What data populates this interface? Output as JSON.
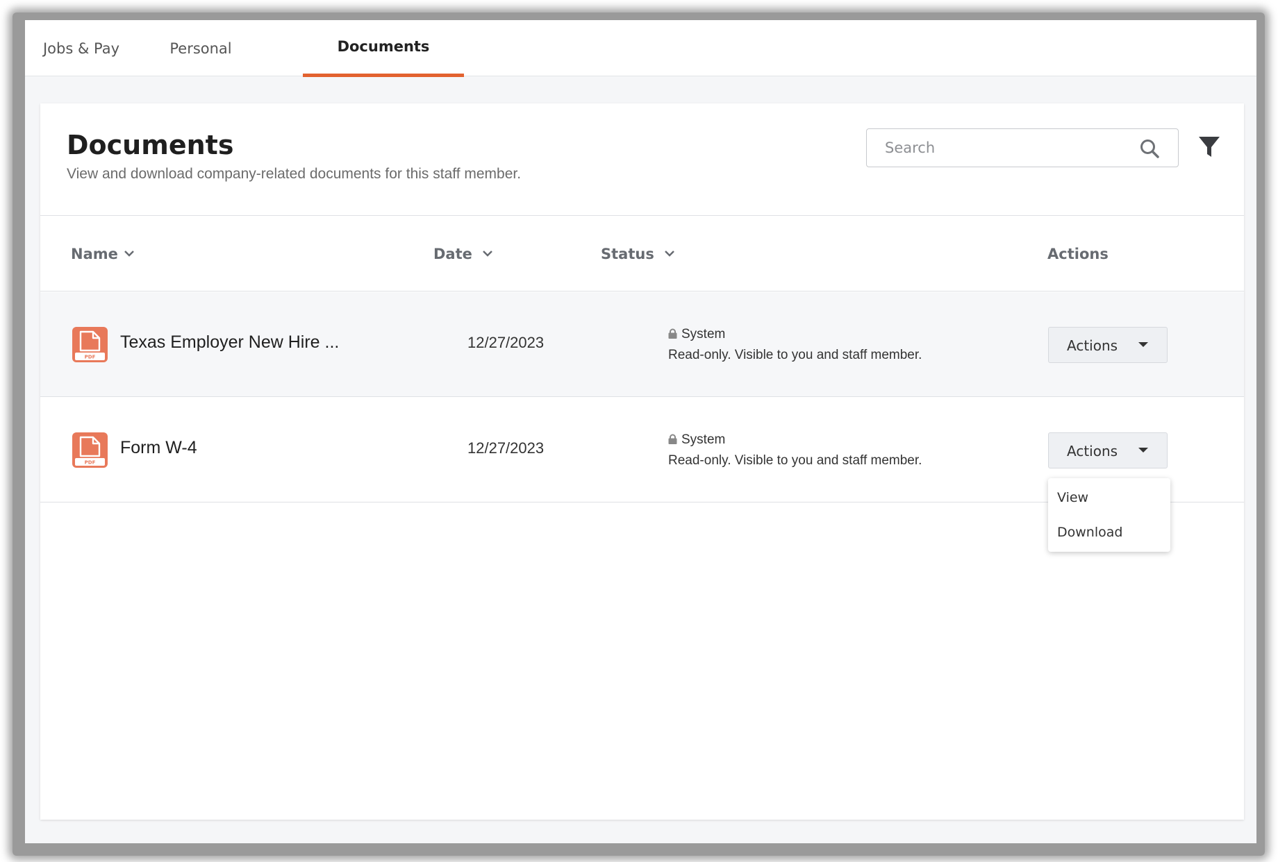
{
  "tabs": [
    {
      "label": "Jobs & Pay"
    },
    {
      "label": "Personal"
    },
    {
      "label": "Documents"
    }
  ],
  "header": {
    "title": "Documents",
    "subtitle": "View and download company-related documents for this staff member."
  },
  "search": {
    "placeholder": "Search",
    "value": ""
  },
  "columns": {
    "name": "Name",
    "date": "Date",
    "status": "Status",
    "actions": "Actions"
  },
  "documents": [
    {
      "name": "Texas Employer New Hire ...",
      "date": "12/27/2023",
      "status_title": "System",
      "status_desc": "Read-only. Visible to you and staff member.",
      "action_label": "Actions"
    },
    {
      "name": "Form W-4",
      "date": "12/27/2023",
      "status_title": "System",
      "status_desc": "Read-only. Visible to you and staff member.",
      "action_label": "Actions"
    }
  ],
  "pdf_badge": "PDF",
  "actions_menu": [
    {
      "label": "View"
    },
    {
      "label": "Download"
    }
  ],
  "colors": {
    "accent": "#e2622f",
    "pdf_icon": "#e8795a"
  },
  "icons": [
    "search-icon",
    "filter-icon",
    "chevron-down-icon",
    "pdf-file-icon",
    "lock-icon",
    "caret-down-icon"
  ]
}
